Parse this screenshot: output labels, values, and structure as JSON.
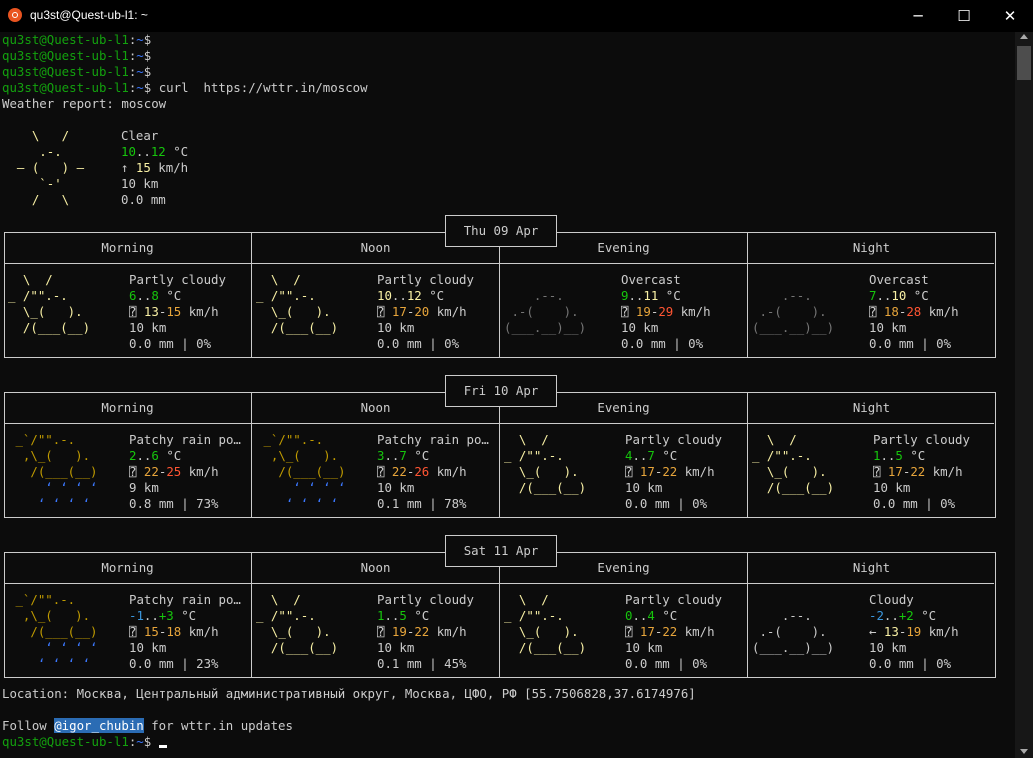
{
  "window": {
    "title": "qu3st@Quest-ub-l1: ~",
    "minimize": "─",
    "maximize": "☐",
    "close": "✕"
  },
  "prompt": {
    "user": "qu3st@Quest-ub-l1",
    "path": "~",
    "symbol": "$"
  },
  "command": " curl  https://wttr.in/moscow",
  "report_title": "Weather report: moscow",
  "current": {
    "art": [
      "    \\   /    ",
      "     .-.     ",
      "  ― (   ) ―  ",
      "     `-'     ",
      "    /   \\    "
    ],
    "condition": "Clear",
    "temp": "10..12",
    "temp_unit": "°C",
    "wind_arrow": "↑",
    "wind": "15",
    "wind_unit": "km/h",
    "visibility": "10 km",
    "precip": "0.0 mm"
  },
  "columns": [
    "Morning",
    "Noon",
    "Evening",
    "Night"
  ],
  "days": [
    {
      "label": "Thu 09 Apr",
      "periods": [
        {
          "art": [
            "  \\  /   ",
            "_ /\"\".-.  ",
            "  \\_(   ). ",
            "  /(___(__) "
          ],
          "cond": "Partly cloudy",
          "temp_lo": "6",
          "temp_hi": "8",
          "wind_arrow": "⍰",
          "wind_lo": "13",
          "wind_hi": "15",
          "vis": "10 km",
          "precip": "0.0 mm | 0%",
          "style": "sun"
        },
        {
          "art": [
            "  \\  /   ",
            "_ /\"\".-.  ",
            "  \\_(   ). ",
            "  /(___(__) "
          ],
          "cond": "Partly cloudy",
          "temp_lo": "10",
          "temp_hi": "12",
          "wind_arrow": "⍰",
          "wind_lo": "17",
          "wind_hi": "20",
          "vis": "10 km",
          "precip": "0.0 mm | 0%",
          "style": "sun"
        },
        {
          "art": [
            "",
            "    .--.   ",
            " .-(    ).  ",
            "(___.__)__) "
          ],
          "cond": "Overcast",
          "temp_lo": "9",
          "temp_hi": "11",
          "wind_arrow": "⍰",
          "wind_lo": "19",
          "wind_hi": "29",
          "vis": "10 km",
          "precip": "0.0 mm | 0%",
          "style": "cloud"
        },
        {
          "art": [
            "",
            "    .--.   ",
            " .-(    ).  ",
            "(___.__)__) "
          ],
          "cond": "Overcast",
          "temp_lo": "7",
          "temp_hi": "10",
          "wind_arrow": "⍰",
          "wind_lo": "18",
          "wind_hi": "28",
          "vis": "10 km",
          "precip": "0.0 mm | 0%",
          "style": "cloud"
        }
      ]
    },
    {
      "label": "Fri 10 Apr",
      "periods": [
        {
          "art": [
            " _`/\"\".-.  ",
            "  ,\\_(   ). ",
            "   /(___(__) ",
            "     ʻ ʻ ʻ ʻ ",
            "    ʻ ʻ ʻ ʻ  "
          ],
          "cond": "Patchy rain po…",
          "temp_lo": "2",
          "temp_hi": "6",
          "wind_arrow": "⍰",
          "wind_lo": "22",
          "wind_hi": "25",
          "vis": "9 km",
          "precip": "0.8 mm | 73%",
          "style": "rain"
        },
        {
          "art": [
            " _`/\"\".-.  ",
            "  ,\\_(   ). ",
            "   /(___(__) ",
            "     ʻ ʻ ʻ ʻ ",
            "    ʻ ʻ ʻ ʻ  "
          ],
          "cond": "Patchy rain po…",
          "temp_lo": "3",
          "temp_hi": "7",
          "wind_arrow": "⍰",
          "wind_lo": "22",
          "wind_hi": "26",
          "vis": "10 km",
          "precip": "0.1 mm | 78%",
          "style": "rain"
        },
        {
          "art": [
            "  \\  /   ",
            "_ /\"\".-.  ",
            "  \\_(   ). ",
            "  /(___(__) "
          ],
          "cond": "Partly cloudy",
          "temp_lo": "4",
          "temp_hi": "7",
          "wind_arrow": "⍰",
          "wind_lo": "17",
          "wind_hi": "22",
          "vis": "10 km",
          "precip": "0.0 mm | 0%",
          "style": "sun"
        },
        {
          "art": [
            "  \\  /   ",
            "_ /\"\".-.  ",
            "  \\_(   ). ",
            "  /(___(__) "
          ],
          "cond": "Partly cloudy",
          "temp_lo": "1",
          "temp_hi": "5",
          "wind_arrow": "⍰",
          "wind_lo": "17",
          "wind_hi": "22",
          "vis": "10 km",
          "precip": "0.0 mm | 0%",
          "style": "sun"
        }
      ]
    },
    {
      "label": "Sat 11 Apr",
      "periods": [
        {
          "art": [
            " _`/\"\".-.  ",
            "  ,\\_(   ). ",
            "   /(___(__) ",
            "     ʻ ʻ ʻ ʻ ",
            "    ʻ ʻ ʻ ʻ  "
          ],
          "cond": "Patchy rain po…",
          "temp_lo": "-1",
          "temp_hi": "+3",
          "wind_arrow": "⍰",
          "wind_lo": "15",
          "wind_hi": "18",
          "vis": "10 km",
          "precip": "0.0 mm | 23%",
          "style": "rain"
        },
        {
          "art": [
            "  \\  /   ",
            "_ /\"\".-.  ",
            "  \\_(   ). ",
            "  /(___(__) "
          ],
          "cond": "Partly cloudy",
          "temp_lo": "1",
          "temp_hi": "5",
          "wind_arrow": "⍰",
          "wind_lo": "19",
          "wind_hi": "22",
          "vis": "10 km",
          "precip": "0.1 mm | 45%",
          "style": "sun"
        },
        {
          "art": [
            "  \\  /   ",
            "_ /\"\".-.  ",
            "  \\_(   ). ",
            "  /(___(__) "
          ],
          "cond": "Partly cloudy",
          "temp_lo": "0",
          "temp_hi": "4",
          "wind_arrow": "⍰",
          "wind_lo": "17",
          "wind_hi": "22",
          "vis": "10 km",
          "precip": "0.0 mm | 0%",
          "style": "sun"
        },
        {
          "art": [
            "",
            "    .--.   ",
            " .-(    ).  ",
            "(___.__)__) "
          ],
          "cond": "Cloudy",
          "temp_lo": "-2",
          "temp_hi": "+2",
          "wind_arrow": "←",
          "wind_lo": "13",
          "wind_hi": "19",
          "vis": "10 km",
          "precip": "0.0 mm | 0%",
          "style": "cloudw"
        }
      ]
    }
  ],
  "location": "Location: Москва, Центральный административный округ, Москва, ЦФО, РФ [55.7506828,37.6174976]",
  "follow_prefix": "Follow ",
  "follow_handle": "@igor_chubin",
  "follow_suffix": " for wttr.in updates"
}
